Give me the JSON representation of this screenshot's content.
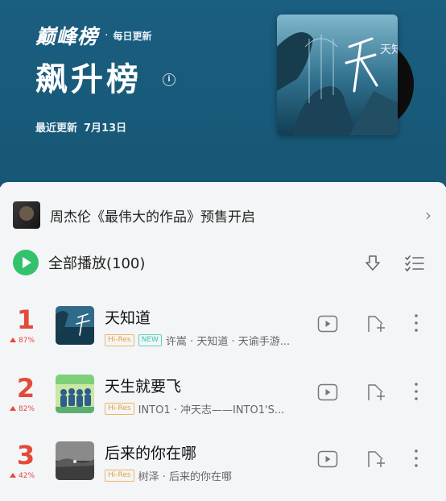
{
  "header": {
    "brand": "巅峰榜",
    "brand_dot": "·",
    "brand_sub": "每日更新",
    "title": "飙升榜",
    "info_icon": "info-icon",
    "update_label": "最近更新",
    "update_date": "7月13日",
    "colors": {
      "header_bg": "#175775",
      "rank": "#e34a3a",
      "play": "#33c26b"
    }
  },
  "album_cover": {
    "title_text": "天知道"
  },
  "presale": {
    "text": "周杰伦《最伟大的作品》预售开启",
    "chevron": "›"
  },
  "playall": {
    "label": "全部播放(100)"
  },
  "songs": [
    {
      "rank": "1",
      "change": "87%",
      "title": "天知道",
      "hires": "Hi-Res",
      "new_badge": "NEW",
      "artist": "许嵩 · 天知道 · 天谕手游..."
    },
    {
      "rank": "2",
      "change": "82%",
      "title": "天生就要飞",
      "hires": "Hi-Res",
      "new_badge": "",
      "artist": "INTO1 · 冲天志——INTO1'S..."
    },
    {
      "rank": "3",
      "change": "42%",
      "title": "后来的你在哪",
      "hires": "Hi-Res",
      "new_badge": "",
      "artist": "树泽 · 后来的你在哪"
    }
  ]
}
